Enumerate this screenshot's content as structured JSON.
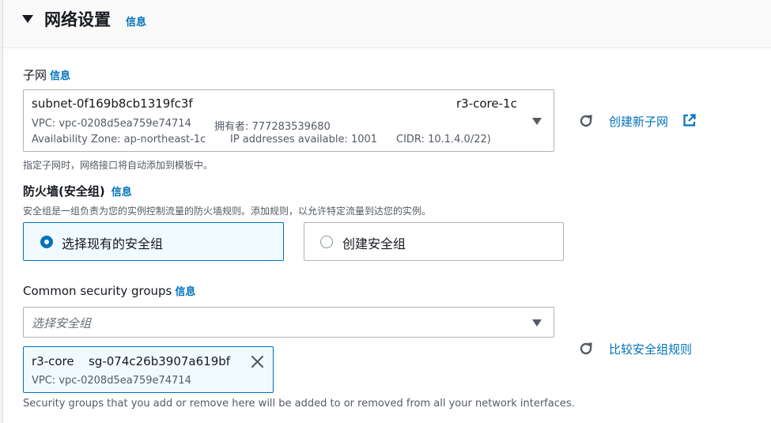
{
  "section": {
    "title": "网络设置",
    "info": "信息"
  },
  "subnet": {
    "label": "子网",
    "info": "信息",
    "selected_id": "subnet-0f169b8cb1319fc3f",
    "selected_name": "r3-core-1c",
    "vpc": "VPC: vpc-0208d5ea759e74714",
    "owner": "拥有者: 777283539680",
    "az": "Availability Zone: ap-northeast-1c",
    "ip_available": "IP addresses available: 1001",
    "cidr": "CIDR: 10.1.4.0/22)",
    "create_link": "创建新子网",
    "hint": "指定子网时，网络接口将自动添加到模板中。"
  },
  "firewall": {
    "label": "防火墙(安全组)",
    "info": "信息",
    "description": "安全组是一组负责为您的实例控制流量的防火墙规则。添加规则，以允许特定流量到达您的实例。",
    "options": [
      {
        "label": "选择现有的安全组",
        "selected": true
      },
      {
        "label": "创建安全组",
        "selected": false
      }
    ]
  },
  "security_groups": {
    "label": "Common security groups",
    "info": "信息",
    "placeholder": "选择安全组",
    "compare_link": "比较安全组规则",
    "selected_token": {
      "name": "r3-core",
      "id": "sg-074c26b3907a619bf",
      "vpc": "VPC: vpc-0208d5ea759e74714"
    },
    "footer": "Security groups that you add or remove here will be added to or removed from all your network interfaces."
  },
  "colors": {
    "accent": "#0073bb",
    "text": "#16191f",
    "muted": "#545b64",
    "border": "#aab7b8"
  },
  "icons": [
    "caret-down-icon",
    "dropdown-arrow-icon",
    "refresh-icon",
    "external-link-icon",
    "close-icon"
  ]
}
